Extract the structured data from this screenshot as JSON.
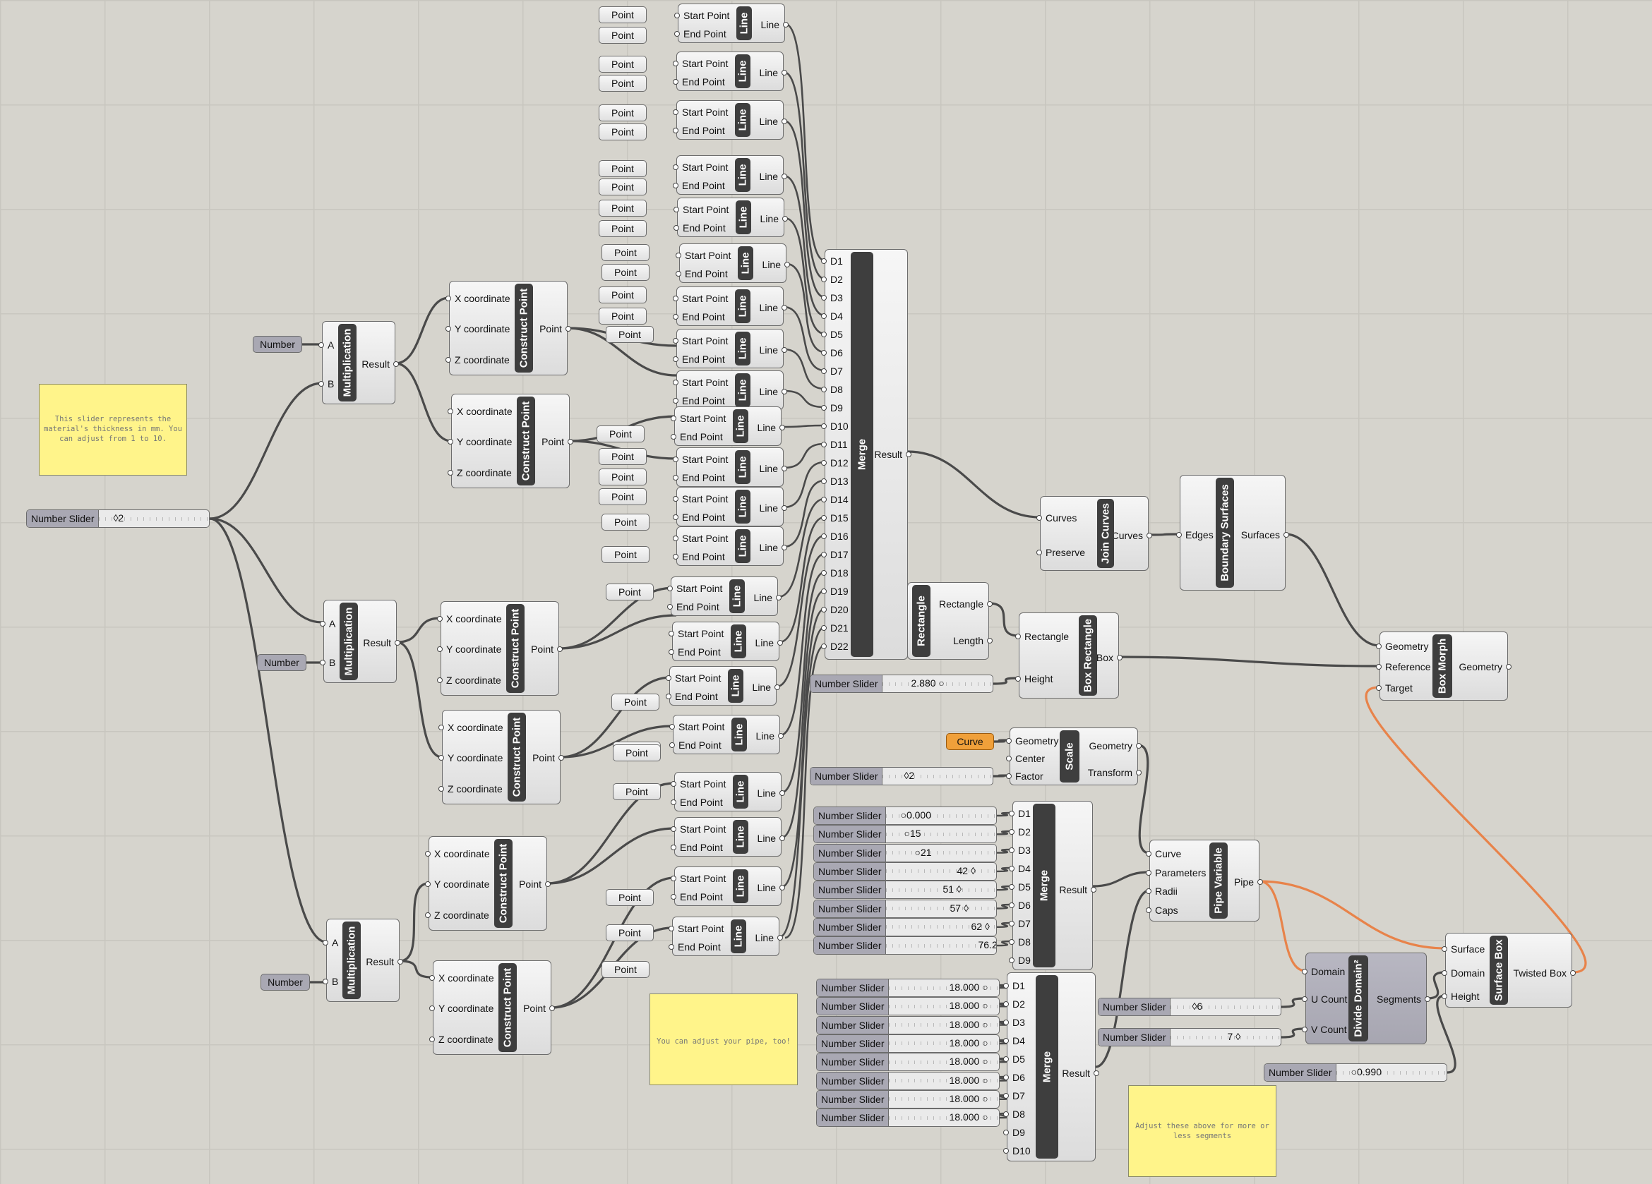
{
  "notes": {
    "thickness": "This slider represents the material's thickness in mm. You can adjust from 1 to 10.",
    "pipe": "You can adjust your pipe, too!",
    "segments": "Adjust these above for more or less segments"
  },
  "labels": {
    "point": "Point",
    "start_point": "Start Point",
    "end_point": "End Point",
    "line": "Line",
    "number": "Number",
    "number_slider": "Number Slider",
    "curve": "Curve",
    "a": "A",
    "b": "B",
    "result": "Result",
    "x_coordinate": "X coordinate",
    "y_coordinate": "Y coordinate",
    "z_coordinate": "Z coordinate",
    "multiplication": "Multiplication",
    "construct_point": "Construct Point",
    "merge": "Merge",
    "curves": "Curves",
    "preserve": "Preserve",
    "join_curves": "Join Curves",
    "edges": "Edges",
    "surfaces": "Surfaces",
    "boundary_surfaces": "Boundary Surfaces",
    "rectangle": "Rectangle",
    "length": "Length",
    "height": "Height",
    "box": "Box",
    "box_rectangle": "Box Rectangle",
    "geometry": "Geometry",
    "reference": "Reference",
    "target": "Target",
    "box_morph": "Box Morph",
    "center": "Center",
    "factor": "Factor",
    "transform": "Transform",
    "scale": "Scale",
    "parameters": "Parameters",
    "radii": "Radii",
    "caps": "Caps",
    "pipe": "Pipe",
    "pipe_variable": "Pipe Variable",
    "domain": "Domain",
    "u_count": "U Count",
    "v_count": "V Count",
    "segments": "Segments",
    "divide_domain": "Divide Domain²",
    "surface": "Surface",
    "twisted_box": "Twisted Box",
    "surface_box": "Surface Box"
  },
  "merge_main_inputs": [
    "D1",
    "D2",
    "D3",
    "D4",
    "D5",
    "D6",
    "D7",
    "D8",
    "D9",
    "D10",
    "D11",
    "D12",
    "D13",
    "D14",
    "D15",
    "D16",
    "D17",
    "D18",
    "D19",
    "D20",
    "D21",
    "D22"
  ],
  "merge_params_inputs": [
    "D1",
    "D2",
    "D3",
    "D4",
    "D5",
    "D6",
    "D7",
    "D8",
    "D9"
  ],
  "merge_radii_inputs": [
    "D1",
    "D2",
    "D3",
    "D4",
    "D5",
    "D6",
    "D7",
    "D8",
    "D9",
    "D10"
  ],
  "sliders": {
    "thickness": "2",
    "length": "2.880",
    "scale_factor": "2",
    "u_count": "6",
    "v_count": "7",
    "height": "0.990",
    "parameters": [
      "0.000",
      "15",
      "21",
      "42",
      "51",
      "57",
      "62",
      "76.219"
    ],
    "radii": [
      "18.000",
      "18.000",
      "18.000",
      "18.000",
      "18.000",
      "18.000",
      "18.000",
      "18.000"
    ]
  },
  "colors": {
    "canvas": "#d6d4cd",
    "wire": "#4a4a4a",
    "selected_wire": "#e8834a",
    "note": "#fff48a",
    "curve_param": "#f0a03a"
  }
}
